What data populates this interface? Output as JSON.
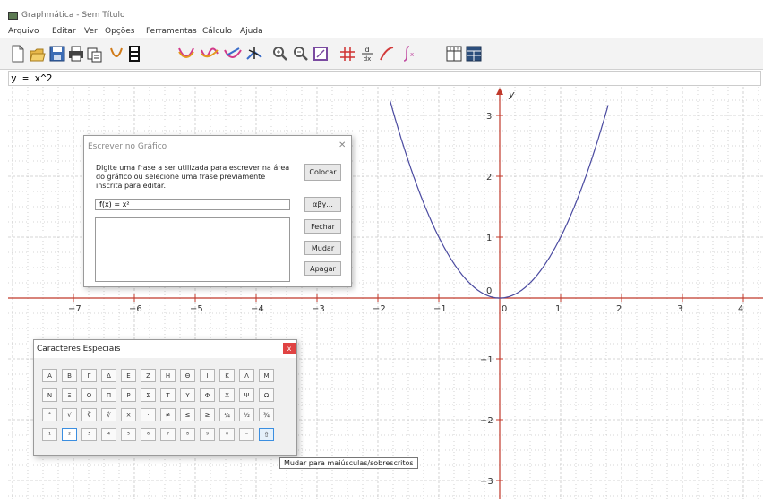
{
  "window": {
    "title": "Graphmática - Sem Título"
  },
  "menu": [
    "Arquivo",
    "Editar",
    "Ver",
    "Opções",
    "Ferramentas",
    "Cálculo",
    "Ajuda"
  ],
  "equation": {
    "value": "y = x^2"
  },
  "graph": {
    "x_labels": [
      "−7",
      "−6",
      "−5",
      "−4",
      "−3",
      "−2",
      "−1",
      "0",
      "1",
      "2",
      "3",
      "4"
    ],
    "y_labels": [
      "3",
      "2",
      "1",
      "0",
      "−1",
      "−2",
      "−3"
    ],
    "y_axis_label": "y",
    "curve": {
      "expression": "y = x^2",
      "color": "#4a4aa0"
    },
    "colors": {
      "axis": "#c0392b",
      "grid": "#c8c8c8"
    }
  },
  "write_dialog": {
    "title": "Escrever no Gráfico",
    "close": "✕",
    "message": "Digite uma frase a ser utilizada para escrever na área do gráfico ou selecione uma frase previamente inscrita para editar.",
    "input_value": "f(x) = x²",
    "buttons": {
      "place": "Colocar",
      "chars": "αβγ...",
      "close": "Fechar",
      "change": "Mudar",
      "delete": "Apagar"
    }
  },
  "chars_dialog": {
    "title": "Caracteres Especiais",
    "close": "x",
    "rows": [
      [
        "Α",
        "Β",
        "Γ",
        "Δ",
        "Ε",
        "Ζ",
        "Η",
        "Θ",
        "Ι",
        "Κ",
        "Λ",
        "Μ"
      ],
      [
        "Ν",
        "Ξ",
        "Ο",
        "Π",
        "Ρ",
        "Σ",
        "Τ",
        "Υ",
        "Φ",
        "Χ",
        "Ψ",
        "Ω"
      ],
      [
        "°",
        "√",
        "∛",
        "∜",
        "×",
        "·",
        "≠",
        "≤",
        "≥",
        "¼",
        "½",
        "¾"
      ],
      [
        "¹",
        "²",
        "³",
        "⁴",
        "⁵",
        "⁶",
        "⁷",
        "⁸",
        "⁹",
        "⁰",
        "⁻",
        "⇧"
      ]
    ]
  },
  "tooltip": "Mudar para maiúsculas/sobrescritos",
  "toolbar_icons": [
    "new-file-icon",
    "open-folder-icon",
    "save-icon",
    "print-icon",
    "copy-icon",
    "tangent-icon",
    "table-icon",
    "curve-1-icon",
    "curve-2-icon",
    "curve-3-icon",
    "trace-icon",
    "zoom-in-icon",
    "zoom-out-icon",
    "zoom-box-icon",
    "grid-icon",
    "derivative-icon",
    "tangent-line-icon",
    "integral-icon",
    "xy-table-icon",
    "data-table-icon"
  ]
}
